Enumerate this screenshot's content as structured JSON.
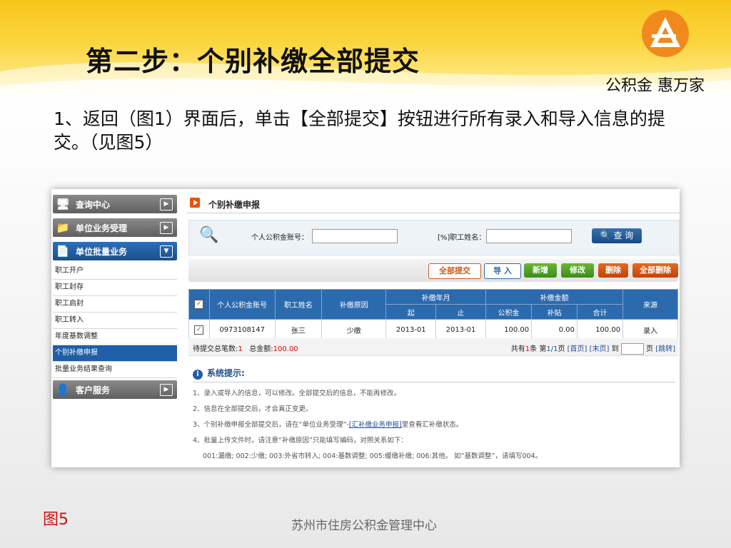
{
  "slide": {
    "title": "第二步：个别补缴全部提交",
    "slogan": "公积金 惠万家",
    "paragraph": "1、返回（图1）界面后，单击【全部提交】按钮进行所有录入和导入信息的提交。（见图5）",
    "figure_label": "图5",
    "footer": "苏州市住房公积金管理中心"
  },
  "sidebar": {
    "main_items": [
      {
        "label": "查询中心",
        "icon": "monitor-icon"
      },
      {
        "label": "单位业务受理",
        "icon": "folder-icon"
      },
      {
        "label": "单位批量业务",
        "icon": "document-icon"
      },
      {
        "label": "客户服务",
        "icon": "person-icon"
      }
    ],
    "sub_items": [
      "职工开户",
      "职工封存",
      "职工启封",
      "职工转入",
      "年度基数调整",
      "个别补缴申报",
      "批量业务结果查询"
    ]
  },
  "panel": {
    "title": "个别补缴申报",
    "search_label1": "个人公积金账号：",
    "search_label2": "[%]职工姓名：",
    "query_button": "查 询",
    "buttons": [
      "全部提交",
      "导 入",
      "新增",
      "修改",
      "删除",
      "全部删除"
    ]
  },
  "table": {
    "headers": {
      "account": "个人公积金账号",
      "name": "职工姓名",
      "reason": "补缴原因",
      "period": "补缴年月",
      "start": "起",
      "end": "止",
      "amount": "补缴金额",
      "fund": "公积金",
      "subsidy": "补贴",
      "total": "合计",
      "source": "来源"
    },
    "rows": [
      {
        "account": "0973108147",
        "name": "张三",
        "reason": "少缴",
        "start": "2013-01",
        "end": "2013-01",
        "fund": "100.00",
        "subsidy": "0.00",
        "total": "100.00",
        "source": "录入"
      }
    ]
  },
  "summary": {
    "pending_label": "待提交总笔数:",
    "pending_count": "1",
    "total_label": "总金额:",
    "total_amount": "100.00",
    "pager_prefix": "共有",
    "count": "1",
    "pager_mid": "条  第",
    "page": "1/1",
    "pager_page": "页",
    "first": "[首页]",
    "last": "[末页]",
    "goto_label": "到",
    "page_label": "页",
    "jump": "[跳转]"
  },
  "tips": {
    "title": "系统提示:",
    "lines": [
      "1、录入或导入的信息，可以修改。全部提交后的信息，不能再修改。",
      "2、信息在全部提交后，才会真正变更。",
      "4、批量上传文件时，请注意“补缴原因”只能填写编码，对照关系如下：",
      "001:漏缴; 002:少缴; 003:外省市转入; 004:基数调整; 005:缓缴补缴; 006:其他。 如“基数调整”，请填写004。"
    ],
    "line3_prefix": "3、个别补缴申报全部提交后，请在“单位业务受理”-",
    "line3_link": "[汇补缴业务申报]",
    "line3_suffix": "里查看汇补缴状态。"
  }
}
